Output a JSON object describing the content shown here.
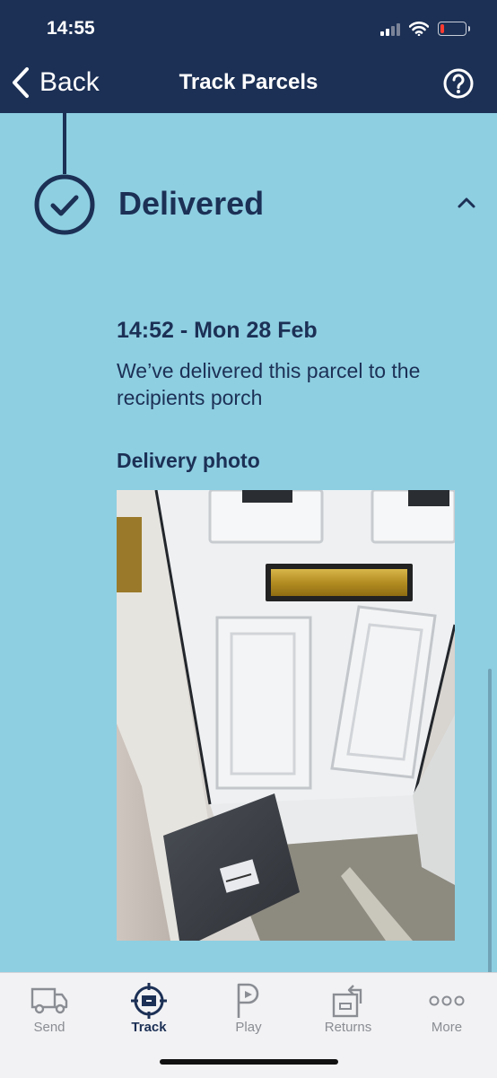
{
  "status_bar": {
    "time": "14:55"
  },
  "header": {
    "back_label": "Back",
    "title": "Track Parcels"
  },
  "tracking": {
    "status": "Delivered",
    "event_time": "14:52 - Mon 28 Feb",
    "event_description": "We’ve delivered this parcel to the recipients porch",
    "photo_heading": "Delivery photo"
  },
  "tabbar": {
    "tabs": [
      {
        "label": "Send",
        "icon": "van-icon"
      },
      {
        "label": "Track",
        "icon": "track-target-icon",
        "active": true
      },
      {
        "label": "Play",
        "icon": "play-p-icon"
      },
      {
        "label": "Returns",
        "icon": "returns-icon"
      },
      {
        "label": "More",
        "icon": "more-dots-icon"
      }
    ]
  },
  "colors": {
    "header_bg": "#1c3055",
    "page_bg": "#8ecfe2",
    "accent": "#1c3055",
    "battery_low": "#ff3b30"
  },
  "battery_level": 0.15
}
